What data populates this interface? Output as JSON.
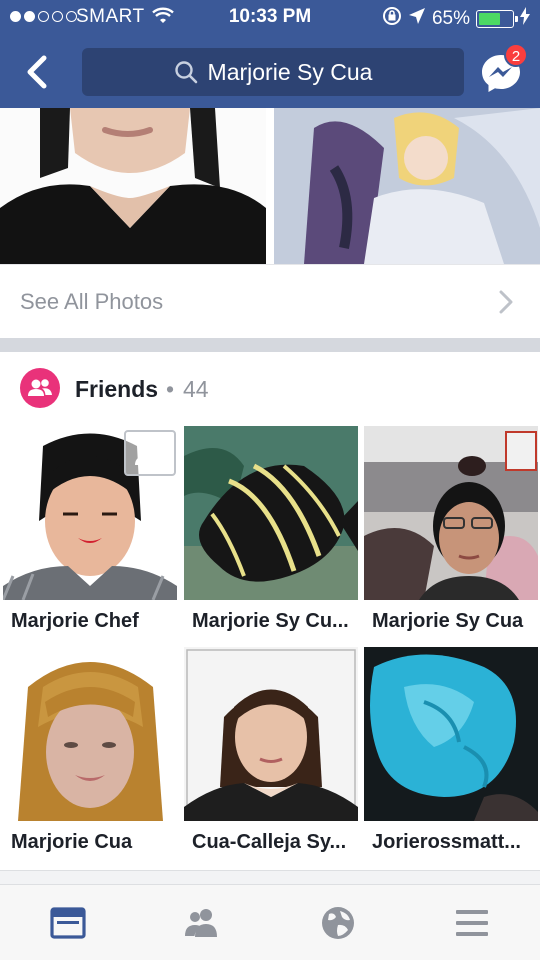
{
  "status_bar": {
    "signal_dots_filled": 2,
    "signal_dots_total": 5,
    "carrier": "SMART",
    "time": "10:33 PM",
    "battery_percent": "65%",
    "battery_level": 0.65
  },
  "nav": {
    "search_text": "Marjorie Sy Cua",
    "messenger_badge": "2"
  },
  "photos": {
    "see_all_label": "See All Photos"
  },
  "friends": {
    "title": "Friends",
    "separator": "•",
    "count": "44",
    "items": [
      {
        "name": "Marjorie Chef"
      },
      {
        "name": "Marjorie Sy Cu..."
      },
      {
        "name": "Marjorie Sy Cua"
      },
      {
        "name": "Marjorie Cua"
      },
      {
        "name": "Cua-Calleja Sy..."
      },
      {
        "name": "Jorierossmatt..."
      }
    ]
  },
  "tabbar": {
    "tabs": [
      {
        "icon": "news-feed-icon",
        "active": true
      },
      {
        "icon": "friend-requests-icon",
        "active": false
      },
      {
        "icon": "globe-notifications-icon",
        "active": false
      },
      {
        "icon": "menu-icon",
        "active": false
      }
    ]
  },
  "colors": {
    "header_blue": "#3b5998",
    "search_blue": "#2d4373",
    "friends_pink": "#e9327a",
    "badge_red": "#fa3e3e",
    "battery_green": "#4cd964",
    "active_tab": "#3b5998",
    "inactive_tab": "#90949c"
  }
}
